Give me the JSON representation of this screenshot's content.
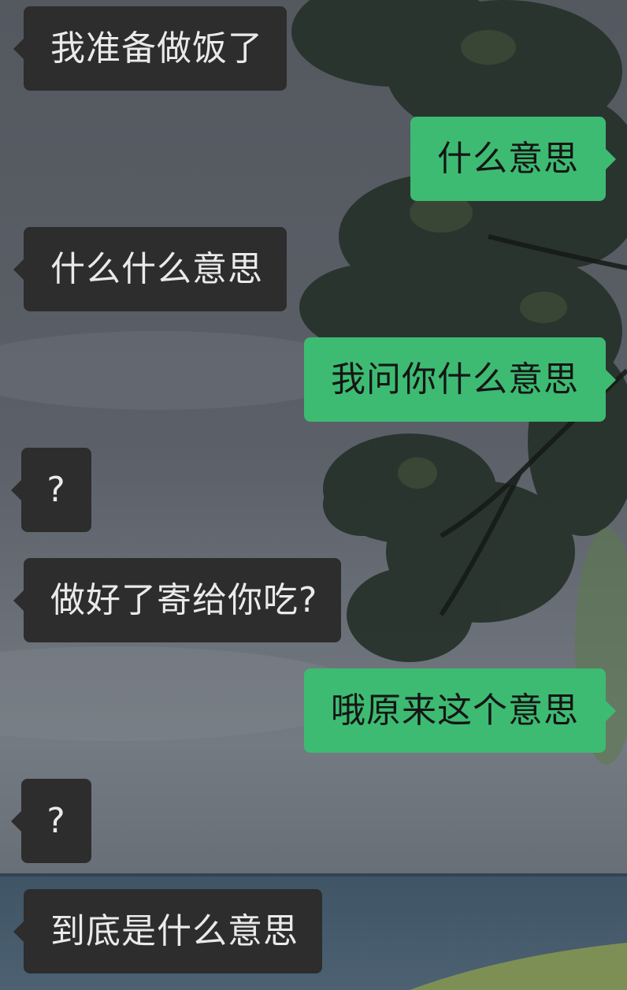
{
  "messages": [
    {
      "side": "incoming",
      "text": "我准备做饭了"
    },
    {
      "side": "outgoing",
      "text": "什么意思"
    },
    {
      "side": "incoming",
      "text": "什么什么意思"
    },
    {
      "side": "outgoing",
      "text": "我问你什么意思"
    },
    {
      "side": "incoming",
      "text": "?"
    },
    {
      "side": "incoming",
      "text": "做好了寄给你吃?"
    },
    {
      "side": "outgoing",
      "text": "哦原来这个意思"
    },
    {
      "side": "incoming",
      "text": "?"
    },
    {
      "side": "incoming",
      "text": "到底是什么意思"
    }
  ],
  "colors": {
    "incoming_bubble": "#2d2d2d",
    "outgoing_bubble": "#3dbb72"
  }
}
